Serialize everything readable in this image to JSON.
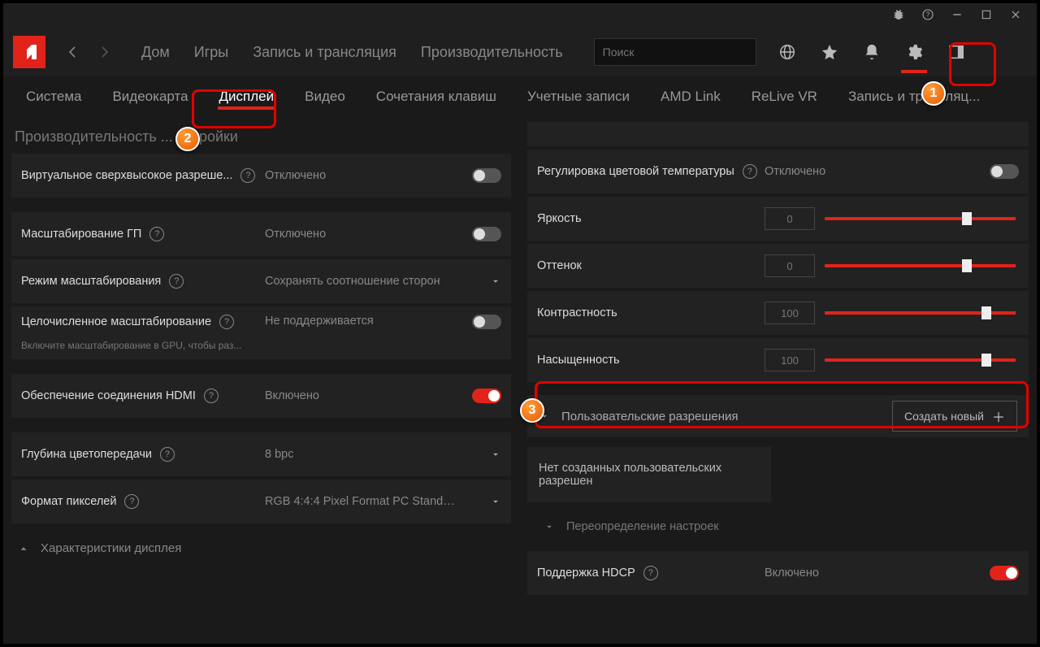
{
  "titlebar": {
    "bug": "bug-icon",
    "help": "help-icon",
    "min": "min",
    "max": "max",
    "close": "close"
  },
  "nav": {
    "home": "Дом",
    "games": "Игры",
    "stream": "Запись и трансляция",
    "perf": "Производительность"
  },
  "search": {
    "placeholder": "Поиск"
  },
  "subtabs": {
    "system": "Система",
    "gpu": "Видеокарта",
    "display": "Дисплей",
    "video": "Видео",
    "hotkeys": "Сочетания клавиш",
    "accounts": "Учетные записи",
    "amdlink": "AMD Link",
    "relive": "ReLive VR",
    "stream": "Запись и трансляц..."
  },
  "left": {
    "section": "Производительность ... астройки",
    "vsr": {
      "label": "Виртуальное сверхвысокое разреше...",
      "value": "Отключено"
    },
    "gpuscale": {
      "label": "Масштабирование ГП",
      "value": "Отключено"
    },
    "scalemode": {
      "label": "Режим масштабирования",
      "value": "Сохранять соотношение сторон"
    },
    "intscale": {
      "label": "Целочисленное масштабирование",
      "sub": "Включите масштабирование в GPU, чтобы раз...",
      "value": "Не поддерживается"
    },
    "hdmi": {
      "label": "Обеспечение соединения HDMI",
      "value": "Включено"
    },
    "depth": {
      "label": "Глубина цветопередачи",
      "value": "8 bpc"
    },
    "pixfmt": {
      "label": "Формат пикселей",
      "value": "RGB 4:4:4 Pixel Format PC Standar..."
    },
    "chars": "Характеристики дисплея"
  },
  "right": {
    "temp": {
      "label": "Регулировка цветовой температуры",
      "value": "Отключено"
    },
    "bright": {
      "label": "Яркость",
      "num": "0",
      "pos": 72
    },
    "tint": {
      "label": "Оттенок",
      "num": "0",
      "pos": 72
    },
    "contrast": {
      "label": "Контрастность",
      "num": "100",
      "pos": 82
    },
    "sat": {
      "label": "Насыщенность",
      "num": "100",
      "pos": 82
    },
    "customres": {
      "label": "Пользовательские разрешения",
      "btn": "Создать новый"
    },
    "nores": "Нет созданных пользовательских разрешен",
    "override": "Переопределение настроек",
    "hdcp": {
      "label": "Поддержка HDCP",
      "value": "Включено"
    }
  },
  "markers": {
    "m1": "1",
    "m2": "2",
    "m3": "3"
  }
}
